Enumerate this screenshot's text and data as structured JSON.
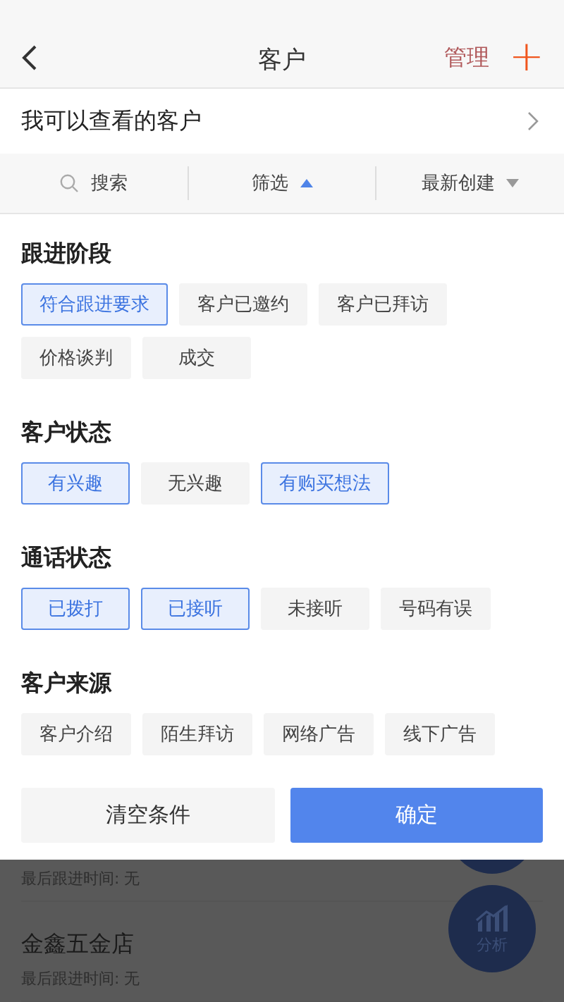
{
  "header": {
    "title": "客户",
    "manage": "管理",
    "add": "+"
  },
  "scope_row": {
    "label": "我可以查看的客户"
  },
  "toolbar": [
    {
      "kind": "search",
      "label": "搜索"
    },
    {
      "kind": "filter",
      "label": "筛选",
      "expanded": true
    },
    {
      "kind": "sort",
      "label": "最新创建",
      "expanded": false
    }
  ],
  "filter_groups": [
    {
      "title": "跟进阶段",
      "options": [
        {
          "label": "符合跟进要求",
          "selected": true
        },
        {
          "label": "客户已邀约",
          "selected": false
        },
        {
          "label": "客户已拜访",
          "selected": false
        },
        {
          "label": "价格谈判",
          "selected": false
        },
        {
          "label": "成交",
          "selected": false
        }
      ]
    },
    {
      "title": "客户状态",
      "options": [
        {
          "label": "有兴趣",
          "selected": true
        },
        {
          "label": "无兴趣",
          "selected": false
        },
        {
          "label": "有购买想法",
          "selected": true
        }
      ]
    },
    {
      "title": "通话状态",
      "options": [
        {
          "label": "已拨打",
          "selected": true
        },
        {
          "label": "已接听",
          "selected": true
        },
        {
          "label": "未接听",
          "selected": false
        },
        {
          "label": "号码有误",
          "selected": false
        }
      ]
    },
    {
      "title": "客户来源",
      "options": [
        {
          "label": "客户介绍",
          "selected": false
        },
        {
          "label": "陌生拜访",
          "selected": false
        },
        {
          "label": "网络广告",
          "selected": false
        },
        {
          "label": "线下广告",
          "selected": false
        }
      ]
    }
  ],
  "actions": {
    "clear": "清空条件",
    "confirm": "确定"
  },
  "customers": [
    {
      "last_follow": "最后跟进时间: 无"
    },
    {
      "name": "金鑫五金店",
      "last_follow": "最后跟进时间: 无"
    }
  ],
  "analysis_button": {
    "label": "分析"
  }
}
